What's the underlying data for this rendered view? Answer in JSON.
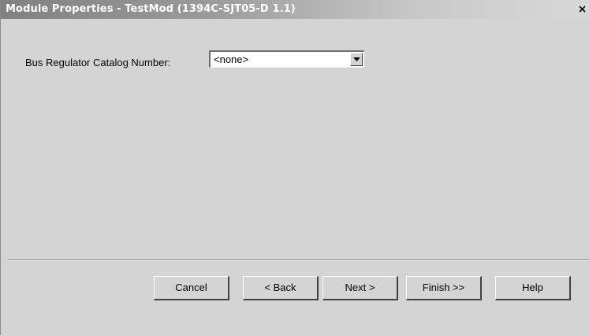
{
  "window": {
    "title": "Module Properties - TestMod (1394C-SJT05-D 1.1)",
    "close_glyph": "×"
  },
  "form": {
    "bus_regulator_label": "Bus Regulator Catalog Number:",
    "bus_regulator_value": "<none>"
  },
  "buttons": {
    "cancel": "Cancel",
    "back": "< Back",
    "next": "Next >",
    "finish": "Finish >>",
    "help": "Help"
  },
  "colors": {
    "dialog_background": "#d4d4d4",
    "title_gradient_start": "#808080",
    "title_gradient_end": "#d8d8d8",
    "title_text": "#ffffff"
  },
  "icons": {
    "close": "close-icon",
    "dropdown": "chevron-down-icon"
  }
}
